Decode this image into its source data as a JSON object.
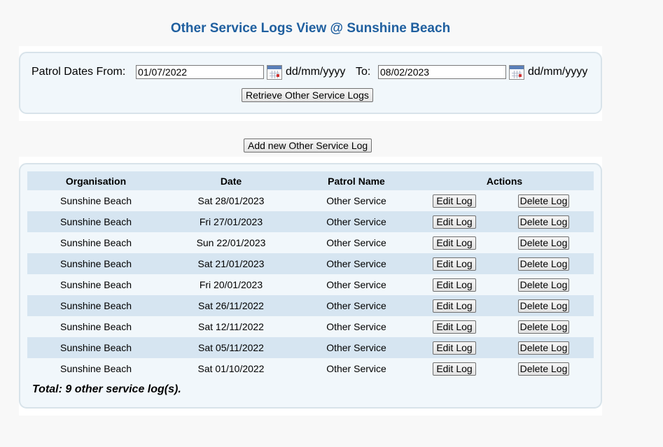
{
  "page_title": "Other Service Logs View @ Sunshine Beach",
  "filter": {
    "from_label": "Patrol Dates From:",
    "from_value": "01/07/2022",
    "from_format": "dd/mm/yyyy",
    "to_label": "To:",
    "to_value": "08/02/2023",
    "to_format": "dd/mm/yyyy",
    "retrieve_label": "Retrieve Other Service Logs"
  },
  "add_button_label": "Add new Other Service Log",
  "table": {
    "headers": {
      "organisation": "Organisation",
      "date": "Date",
      "patrol_name": "Patrol Name",
      "actions": "Actions"
    },
    "edit_label": "Edit Log",
    "delete_label": "Delete Log",
    "rows": [
      {
        "organisation": "Sunshine Beach",
        "date": "Sat 28/01/2023",
        "patrol_name": "Other Service"
      },
      {
        "organisation": "Sunshine Beach",
        "date": "Fri 27/01/2023",
        "patrol_name": "Other Service"
      },
      {
        "organisation": "Sunshine Beach",
        "date": "Sun 22/01/2023",
        "patrol_name": "Other Service"
      },
      {
        "organisation": "Sunshine Beach",
        "date": "Sat 21/01/2023",
        "patrol_name": "Other Service"
      },
      {
        "organisation": "Sunshine Beach",
        "date": "Fri 20/01/2023",
        "patrol_name": "Other Service"
      },
      {
        "organisation": "Sunshine Beach",
        "date": "Sat 26/11/2022",
        "patrol_name": "Other Service"
      },
      {
        "organisation": "Sunshine Beach",
        "date": "Sat 12/11/2022",
        "patrol_name": "Other Service"
      },
      {
        "organisation": "Sunshine Beach",
        "date": "Sat 05/11/2022",
        "patrol_name": "Other Service"
      },
      {
        "organisation": "Sunshine Beach",
        "date": "Sat 01/10/2022",
        "patrol_name": "Other Service"
      }
    ]
  },
  "total_text": "Total: 9 other service log(s).",
  "icons": {
    "calendar_from": "calendar-icon",
    "calendar_to": "calendar-icon"
  },
  "colors": {
    "title": "#1f5f9f",
    "panel_bg": "#f1f7fb",
    "row_alt": "#d6e5f1"
  }
}
